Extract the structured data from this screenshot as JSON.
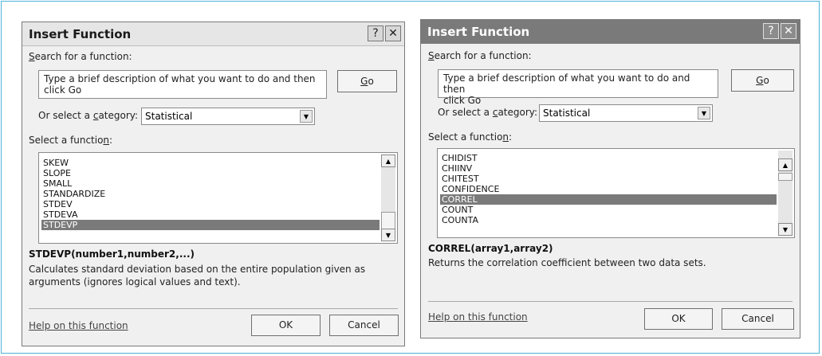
{
  "dialogs": [
    {
      "title": "Insert Function",
      "help_button": "?",
      "close_button": "✕",
      "search_label_mnemonic": "S",
      "search_label_rest": "earch for a function:",
      "search_text_line1": "Type a brief description of what you want to do and then",
      "search_text_line2": "click Go",
      "go_mnemonic": "G",
      "go_rest": "o",
      "category_label_pre": "Or select a ",
      "category_label_mnemonic": "c",
      "category_label_post": "ategory:",
      "category_value": "Statistical",
      "select_label_pre": "Select a functio",
      "select_label_mnemonic": "n",
      "select_label_post": ":",
      "functions": [
        "SKEW",
        "SLOPE",
        "SMALL",
        "STANDARDIZE",
        "STDEV",
        "STDEVA",
        "STDEVP"
      ],
      "selected_function": "STDEVP",
      "signature": "STDEVP(number1,number2,...)",
      "description_line1": "Calculates standard deviation based on the entire population given as",
      "description_line2": "arguments (ignores logical values and text).",
      "help_link": "Help on this function",
      "ok_label": "OK",
      "cancel_label": "Cancel"
    },
    {
      "title": "Insert Function",
      "help_button": "?",
      "close_button": "✕",
      "search_label_mnemonic": "S",
      "search_label_rest": "earch for a function:",
      "search_text_line1": "Type a brief description of what you want to do and then",
      "search_text_line2": "click Go",
      "go_mnemonic": "G",
      "go_rest": "o",
      "category_label_pre": "Or select a ",
      "category_label_mnemonic": "c",
      "category_label_post": "ategory:",
      "category_value": "Statistical",
      "select_label_pre": "Select a functio",
      "select_label_mnemonic": "n",
      "select_label_post": ":",
      "functions": [
        "CHIDIST",
        "CHIINV",
        "CHITEST",
        "CONFIDENCE",
        "CORREL",
        "COUNT",
        "COUNTA"
      ],
      "selected_function": "CORREL",
      "signature": "CORREL(array1,array2)",
      "description_line1": "Returns the correlation coefficient between two data sets.",
      "description_line2": "",
      "help_link": "Help on this function",
      "ok_label": "OK",
      "cancel_label": "Cancel"
    }
  ],
  "colors": {
    "frame": "#4fb3d9",
    "dialog_bg": "#f0f0f0",
    "left_titlebar": "#e6e6e6",
    "right_titlebar": "#7a7a7a",
    "selection": "#7a7a7a"
  },
  "icons": {
    "help": "question-mark-icon",
    "close": "close-icon",
    "dropdown": "chevron-down-icon",
    "scroll_up": "scroll-up-icon",
    "scroll_down": "scroll-down-icon"
  }
}
